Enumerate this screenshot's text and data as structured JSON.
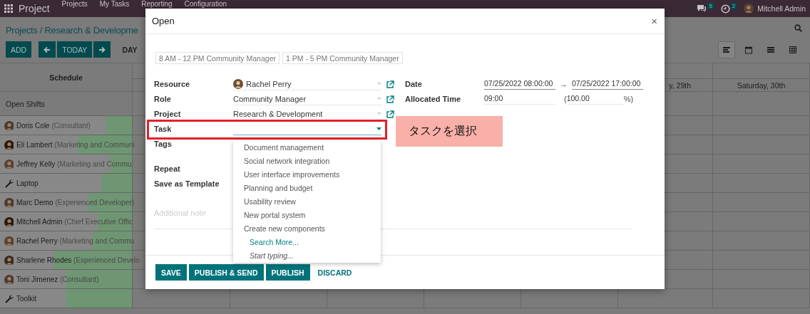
{
  "navbar": {
    "app": "Project",
    "menu": [
      "Projects",
      "My Tasks",
      "Reporting",
      "Configuration"
    ],
    "messages_badge": "5",
    "activities_badge": "2",
    "user": "Mitchell Admin"
  },
  "control_panel": {
    "breadcrumb": "Projects / Research & Developme",
    "add": "ADD",
    "today": "TODAY",
    "scales": [
      "DAY"
    ],
    "views": [
      {
        "kind": "gantt",
        "selected": true
      },
      {
        "kind": "calendar",
        "selected": false
      },
      {
        "kind": "list",
        "selected": false
      },
      {
        "kind": "pivot",
        "selected": false
      }
    ]
  },
  "gantt": {
    "schedule_header": "Schedule",
    "day_headers": [
      "y, 29th",
      "Saturday, 30th"
    ],
    "rows": [
      {
        "kind": "group",
        "name": "Open Shifts"
      },
      {
        "kind": "person",
        "name": "Doris Cole",
        "role": "(Consultant)",
        "level": 0.2
      },
      {
        "kind": "person",
        "name": "Eli Lambert",
        "role": "(Marketing and Communi",
        "level": 0.41
      },
      {
        "kind": "person",
        "name": "Jeffrey Kelly",
        "role": "(Marketing and Commu",
        "level": 0.16
      },
      {
        "kind": "equipment",
        "name": "Laptop",
        "level": 0.23
      },
      {
        "kind": "person",
        "name": "Marc Demo",
        "role": "(Experienced Developer)",
        "level": 0.33
      },
      {
        "kind": "person",
        "name": "Mitchell Admin",
        "role": "(Chief Executive Offic",
        "level": 0.26
      },
      {
        "kind": "person",
        "name": "Rachel Perry",
        "role": "(Marketing and Commu",
        "level": 0.3
      },
      {
        "kind": "person",
        "name": "Sharlene Rhodes",
        "role": "(Experienced Develo",
        "level": 0.59
      },
      {
        "kind": "person",
        "name": "Toni Jimenez",
        "role": "(Consultant)",
        "level": 0.5
      },
      {
        "kind": "equipment",
        "name": "Toolkit",
        "level": 0.5
      }
    ]
  },
  "dialog": {
    "title": "Open",
    "close": "×",
    "templates": [
      "8 AM - 12 PM Community Manager",
      "1 PM - 5 PM Community Manager"
    ],
    "fields": [
      {
        "kind": "avatar",
        "label": "Resource",
        "value": "Rachel Perry"
      },
      {
        "kind": "many2one",
        "label": "Role",
        "value": "Community Manager"
      },
      {
        "kind": "many2one",
        "label": "Project",
        "value": "Research & Development"
      },
      {
        "kind": "focused",
        "label": "Task"
      },
      {
        "kind": "tags",
        "label": "Tags"
      },
      {
        "kind": "spacer",
        "label": "Repeat"
      },
      {
        "kind": "spacer",
        "label": "Save as Template"
      }
    ],
    "date_label": "Date",
    "date_start": "07/25/2022 08:00:00",
    "date_arrow": "→",
    "date_end": "07/25/2022 17:00:00",
    "allocated_label": "Allocated Time",
    "allocated": "09:00",
    "percent_open": "(",
    "percent": "100.00",
    "percent_close": "%)",
    "note_placeholder": "Additional note",
    "buttons": [
      {
        "kind": "primary",
        "label": "SAVE"
      },
      {
        "kind": "primary",
        "label": "PUBLISH & SEND"
      },
      {
        "kind": "primary",
        "label": "PUBLISH"
      },
      {
        "kind": "link",
        "label": "DISCARD"
      }
    ]
  },
  "dropdown": {
    "items": [
      {
        "kind": "task",
        "label": "Document management"
      },
      {
        "kind": "task",
        "label": "Social network integration"
      },
      {
        "kind": "task",
        "label": "User interface improvements"
      },
      {
        "kind": "task",
        "label": "Planning and budget"
      },
      {
        "kind": "task",
        "label": "Usability review"
      },
      {
        "kind": "task",
        "label": "New portal system"
      },
      {
        "kind": "task",
        "label": "Create new components"
      },
      {
        "kind": "link",
        "label": "Search More..."
      },
      {
        "kind": "hint",
        "label": "Start typing..."
      }
    ]
  },
  "callout": {
    "label": "タスクを選択"
  }
}
